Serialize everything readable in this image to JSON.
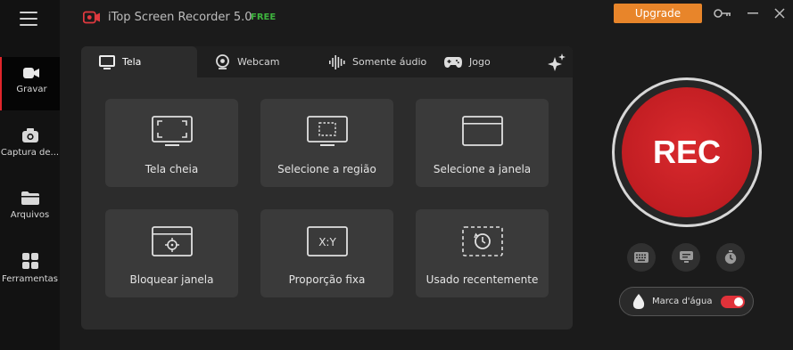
{
  "app": {
    "title": "iTop Screen Recorder 5.0",
    "badge": "FREE",
    "upgrade_label": "Upgrade"
  },
  "sidebar": {
    "items": [
      {
        "label": "Gravar",
        "icon": "video-camera-icon",
        "active": true
      },
      {
        "label": "Captura de...",
        "icon": "camera-icon",
        "active": false
      },
      {
        "label": "Arquivos",
        "icon": "folder-icon",
        "active": false
      },
      {
        "label": "Ferramentas",
        "icon": "grid-icon",
        "active": false
      }
    ]
  },
  "tabs": [
    {
      "label": "Tela",
      "icon": "monitor-icon",
      "active": true
    },
    {
      "label": "Webcam",
      "icon": "webcam-icon",
      "active": false
    },
    {
      "label": "Somente áudio",
      "icon": "audio-wave-icon",
      "active": false
    },
    {
      "label": "Jogo",
      "icon": "gamepad-icon",
      "active": false
    }
  ],
  "modes": [
    {
      "label": "Tela cheia",
      "icon": "full-screen-icon"
    },
    {
      "label": "Selecione a região",
      "icon": "select-region-icon"
    },
    {
      "label": "Selecione a janela",
      "icon": "select-window-icon"
    },
    {
      "label": "Bloquear janela",
      "icon": "lock-window-icon"
    },
    {
      "label": "Proporção fixa",
      "icon": "fixed-ratio-icon"
    },
    {
      "label": "Usado recentemente",
      "icon": "recent-icon"
    }
  ],
  "ratio_icon_text": "X:Y",
  "rec": {
    "label": "REC"
  },
  "watermark": {
    "label": "Marca d'água",
    "enabled": true
  },
  "colors": {
    "accent": "#e8852a",
    "rec_red": "#c11d22",
    "free_green": "#3db33d",
    "toggle_on": "#e0323a"
  }
}
